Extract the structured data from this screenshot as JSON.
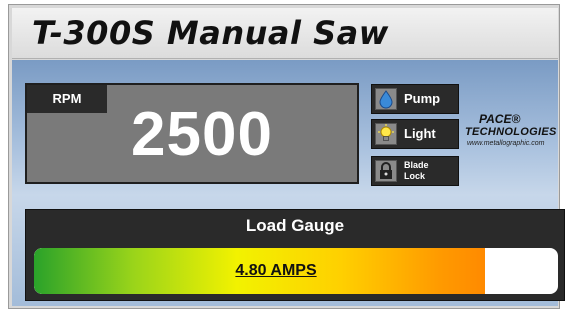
{
  "title": "T-300S Manual Saw",
  "rpm": {
    "label": "RPM",
    "value": "2500"
  },
  "buttons": [
    {
      "label": "Pump",
      "icon": "water-drop-icon"
    },
    {
      "label": "Light",
      "icon": "light-bulb-icon"
    },
    {
      "label_line1": "Blade",
      "label_line2": "Lock",
      "icon": "padlock-icon"
    }
  ],
  "logo": {
    "line1": "PACE®",
    "line2": "TECHNOLOGIES",
    "line3": "www.metallographic.com"
  },
  "gauge": {
    "title": "Load Gauge",
    "reading": "4.80 AMPS",
    "fill_fraction": 0.86
  },
  "colors": {
    "panel_blue": "#a9c1de",
    "display_gray": "#7a7a7a",
    "dark": "#2a2a2a"
  }
}
